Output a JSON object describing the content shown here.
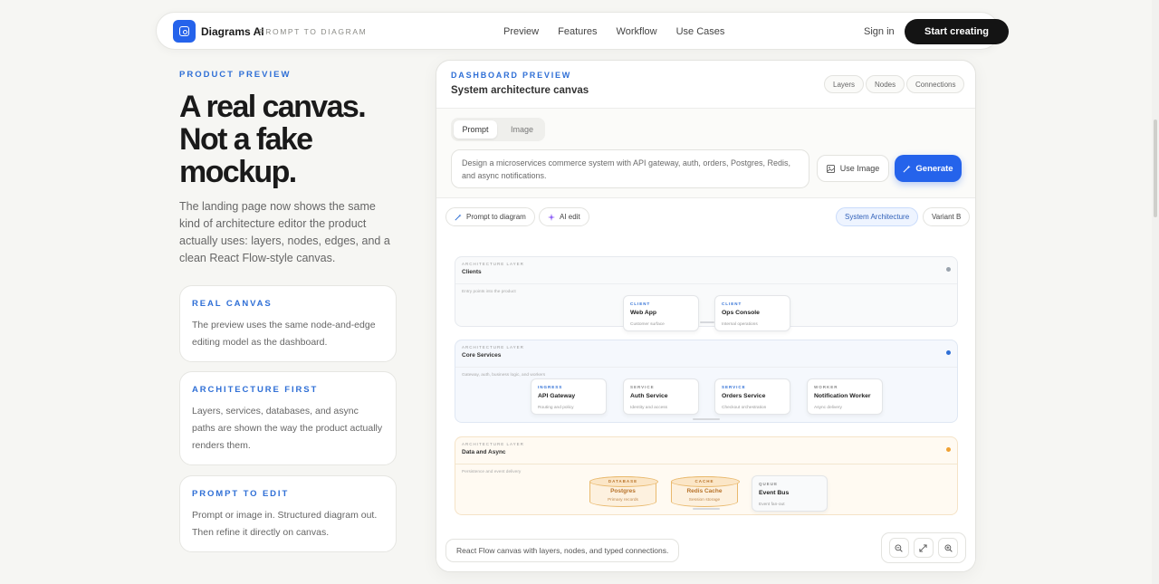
{
  "nav": {
    "brand": "Diagrams AI",
    "tagline": "PROMPT TO DIAGRAM",
    "links": [
      "Preview",
      "Features",
      "Workflow",
      "Use Cases"
    ],
    "sign_in": "Sign in",
    "cta": "Start creating",
    "logo_icon": "diagram-logo-icon",
    "accent": "#2563eb"
  },
  "hero": {
    "eyebrow": "PRODUCT PREVIEW",
    "headline": "A real canvas. Not a fake mockup.",
    "lede": "The landing page now shows the same kind of architecture editor the product actually uses: layers, nodes, edges, and a clean React Flow-style canvas."
  },
  "cards": [
    {
      "title": "REAL CANVAS",
      "body": "The preview uses the same node-and-edge editing model as the dashboard."
    },
    {
      "title": "ARCHITECTURE FIRST",
      "body": "Layers, services, databases, and async paths are shown the way the product actually renders them."
    },
    {
      "title": "PROMPT TO EDIT",
      "body": "Prompt or image in. Structured diagram out. Then refine it directly on canvas."
    }
  ],
  "preview": {
    "eyebrow": "DASHBOARD PREVIEW",
    "title": "System architecture canvas",
    "chips": [
      "Layers",
      "Nodes",
      "Connections"
    ],
    "tabs": {
      "prompt": "Prompt",
      "image": "Image"
    },
    "prompt_text": "Design a microservices commerce system with API gateway, auth, orders, Postgres, Redis, and async notifications.",
    "use_image": "Use Image",
    "generate": "Generate",
    "tools": {
      "prompt_to_diagram": "Prompt to diagram",
      "ai_edit": "AI edit"
    },
    "variants": {
      "system": "System Architecture",
      "variant_b": "Variant B"
    },
    "footer_note": "React Flow canvas with layers, nodes, and typed connections.",
    "zoom": {
      "out": "−",
      "fit": "⤢",
      "in": "+"
    }
  },
  "canvas": {
    "layers": [
      {
        "eyebrow": "ARCHITECTURE LAYER",
        "name": "Clients",
        "desc": "Entry points into the product",
        "dot_color": "#9aa3ad",
        "nodes": [
          {
            "kind": "CLIENT",
            "name": "Web App",
            "sub": "Customer surface"
          },
          {
            "kind": "CLIENT",
            "name": "Ops Console",
            "sub": "Internal operations"
          }
        ]
      },
      {
        "eyebrow": "ARCHITECTURE LAYER",
        "name": "Core Services",
        "desc": "Gateway, auth, business logic, and workers",
        "dot_color": "#2f6fd6",
        "nodes": [
          {
            "kind": "INGRESS",
            "name": "API Gateway",
            "sub": "Routing and policy"
          },
          {
            "kind": "SERVICE",
            "name": "Auth Service",
            "sub": "Identity and access"
          },
          {
            "kind": "SERVICE",
            "name": "Orders Service",
            "sub": "Checkout orchestration"
          },
          {
            "kind": "WORKER",
            "name": "Notification Worker",
            "sub": "Async delivery"
          }
        ]
      },
      {
        "eyebrow": "ARCHITECTURE LAYER",
        "name": "Data and Async",
        "desc": "Persistence and event delivery",
        "dot_color": "#f0a133",
        "nodes": [
          {
            "kind": "DATABASE",
            "name": "Postgres",
            "sub": "Primary records"
          },
          {
            "kind": "CACHE",
            "name": "Redis Cache",
            "sub": "Session storage"
          },
          {
            "kind": "QUEUE",
            "name": "Event Bus",
            "sub": "Event fan-out"
          }
        ]
      }
    ]
  }
}
